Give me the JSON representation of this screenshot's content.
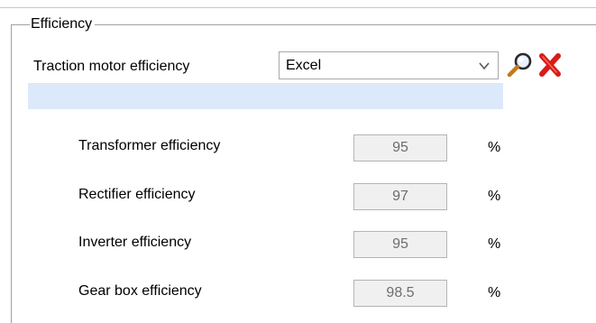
{
  "group": {
    "title": "Efficiency"
  },
  "traction": {
    "label": "Traction motor efficiency",
    "selected": "Excel",
    "accent": "#dce9fb"
  },
  "icons": {
    "browse": "magnifier-icon",
    "delete": "red-x-icon"
  },
  "rows": [
    {
      "label": "Transformer efficiency",
      "value": "95",
      "unit": "%"
    },
    {
      "label": "Rectifier efficiency",
      "value": "97",
      "unit": "%"
    },
    {
      "label": "Inverter efficiency",
      "value": "95",
      "unit": "%"
    },
    {
      "label": "Gear box efficiency",
      "value": "98.5",
      "unit": "%"
    }
  ]
}
